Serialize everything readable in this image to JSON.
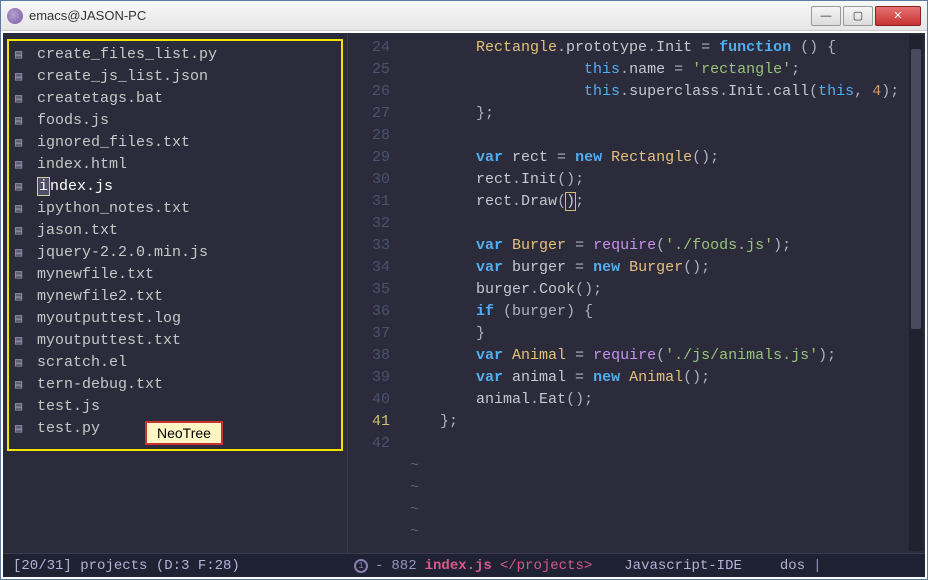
{
  "window": {
    "title": "emacs@JASON-PC"
  },
  "sidebar": {
    "files": [
      "create_files_list.py",
      "create_js_list.json",
      "createtags.bat",
      "foods.js",
      "ignored_files.txt",
      "index.html",
      "index.js",
      "ipython_notes.txt",
      "jason.txt",
      "jquery-2.2.0.min.js",
      "mynewfile.txt",
      "mynewfile2.txt",
      "myoutputtest.log",
      "myoutputtest.txt",
      "scratch.el",
      "tern-debug.txt",
      "test.js",
      "test.py"
    ],
    "selected_index": 6,
    "annotation_label": "NeoTree"
  },
  "editor": {
    "first_line_number": 24,
    "current_line_number": 41,
    "lines": [
      [
        [
          "tok-type",
          "Rectangle"
        ],
        [
          "tok-punc",
          "."
        ],
        [
          "tok-prop",
          "prototype"
        ],
        [
          "tok-punc",
          "."
        ],
        [
          "tok-prop",
          "Init"
        ],
        [
          "tok-punc",
          " = "
        ],
        [
          "tok-kw",
          "function"
        ],
        [
          "tok-punc",
          " () {"
        ]
      ],
      [
        [
          "tok-this",
          "    this"
        ],
        [
          "tok-punc",
          "."
        ],
        [
          "tok-prop",
          "name"
        ],
        [
          "tok-punc",
          " = "
        ],
        [
          "tok-str",
          "'rectangle'"
        ],
        [
          "tok-punc",
          ";"
        ]
      ],
      [
        [
          "tok-this",
          "    this"
        ],
        [
          "tok-punc",
          "."
        ],
        [
          "tok-prop",
          "superclass"
        ],
        [
          "tok-punc",
          "."
        ],
        [
          "tok-prop",
          "Init"
        ],
        [
          "tok-punc",
          "."
        ],
        [
          "tok-prop",
          "call"
        ],
        [
          "tok-punc",
          "("
        ],
        [
          "tok-this",
          "this"
        ],
        [
          "tok-punc",
          ", "
        ],
        [
          "tok-num",
          "4"
        ],
        [
          "tok-punc",
          ");"
        ]
      ],
      [
        [
          "tok-punc",
          "};"
        ]
      ],
      [],
      [
        [
          "tok-kw",
          "var"
        ],
        [
          "tok-default",
          " rect "
        ],
        [
          "tok-punc",
          "= "
        ],
        [
          "tok-kw",
          "new"
        ],
        [
          "tok-default",
          " "
        ],
        [
          "tok-type",
          "Rectangle"
        ],
        [
          "tok-punc",
          "();"
        ]
      ],
      [
        [
          "tok-default",
          "rect"
        ],
        [
          "tok-punc",
          "."
        ],
        [
          "tok-prop",
          "Init"
        ],
        [
          "tok-punc",
          "();"
        ]
      ],
      [
        [
          "tok-default",
          "rect"
        ],
        [
          "tok-punc",
          "."
        ],
        [
          "tok-prop",
          "Draw"
        ],
        [
          "tok-punc",
          "("
        ],
        [
          "tok-boxed",
          ")"
        ],
        [
          "tok-punc",
          ";"
        ]
      ],
      [],
      [
        [
          "tok-kw",
          "var"
        ],
        [
          "tok-default",
          " "
        ],
        [
          "tok-type",
          "Burger"
        ],
        [
          "tok-punc",
          " = "
        ],
        [
          "tok-fn",
          "require"
        ],
        [
          "tok-punc",
          "("
        ],
        [
          "tok-str",
          "'./foods.js'"
        ],
        [
          "tok-punc",
          ");"
        ]
      ],
      [
        [
          "tok-kw",
          "var"
        ],
        [
          "tok-default",
          " burger "
        ],
        [
          "tok-punc",
          "= "
        ],
        [
          "tok-kw",
          "new"
        ],
        [
          "tok-default",
          " "
        ],
        [
          "tok-type",
          "Burger"
        ],
        [
          "tok-punc",
          "();"
        ]
      ],
      [
        [
          "tok-default",
          "burger"
        ],
        [
          "tok-punc",
          "."
        ],
        [
          "tok-prop",
          "Cook"
        ],
        [
          "tok-punc",
          "();"
        ]
      ],
      [
        [
          "tok-kw",
          "if"
        ],
        [
          "tok-punc",
          " (burger) {"
        ]
      ],
      [
        [
          "tok-punc",
          "}"
        ]
      ],
      [
        [
          "tok-kw",
          "var"
        ],
        [
          "tok-default",
          " "
        ],
        [
          "tok-type",
          "Animal"
        ],
        [
          "tok-punc",
          " = "
        ],
        [
          "tok-fn",
          "require"
        ],
        [
          "tok-punc",
          "("
        ],
        [
          "tok-str",
          "'./js/animals.js'"
        ],
        [
          "tok-punc",
          ");"
        ]
      ],
      [
        [
          "tok-kw",
          "var"
        ],
        [
          "tok-default",
          " animal "
        ],
        [
          "tok-punc",
          "= "
        ],
        [
          "tok-kw",
          "new"
        ],
        [
          "tok-default",
          " "
        ],
        [
          "tok-type",
          "Animal"
        ],
        [
          "tok-punc",
          "();"
        ]
      ],
      [
        [
          "tok-default",
          "animal"
        ],
        [
          "tok-punc",
          "."
        ],
        [
          "tok-prop",
          "Eat"
        ],
        [
          "tok-punc",
          "();"
        ]
      ],
      [
        [
          "tok-punc",
          "};"
        ]
      ],
      []
    ],
    "tilde_rows": 4,
    "indents": [
      2,
      4,
      4,
      2,
      0,
      2,
      2,
      2,
      0,
      2,
      2,
      2,
      2,
      2,
      2,
      2,
      2,
      1,
      0
    ]
  },
  "modeline": {
    "left": "[20/31] projects (D:3 F:28)",
    "sep_char": "1",
    "dash": "-",
    "col": "882",
    "file": "index.js",
    "path": "</projects>",
    "mode": "Javascript-IDE",
    "encoding": "dos",
    "tail": "|"
  }
}
